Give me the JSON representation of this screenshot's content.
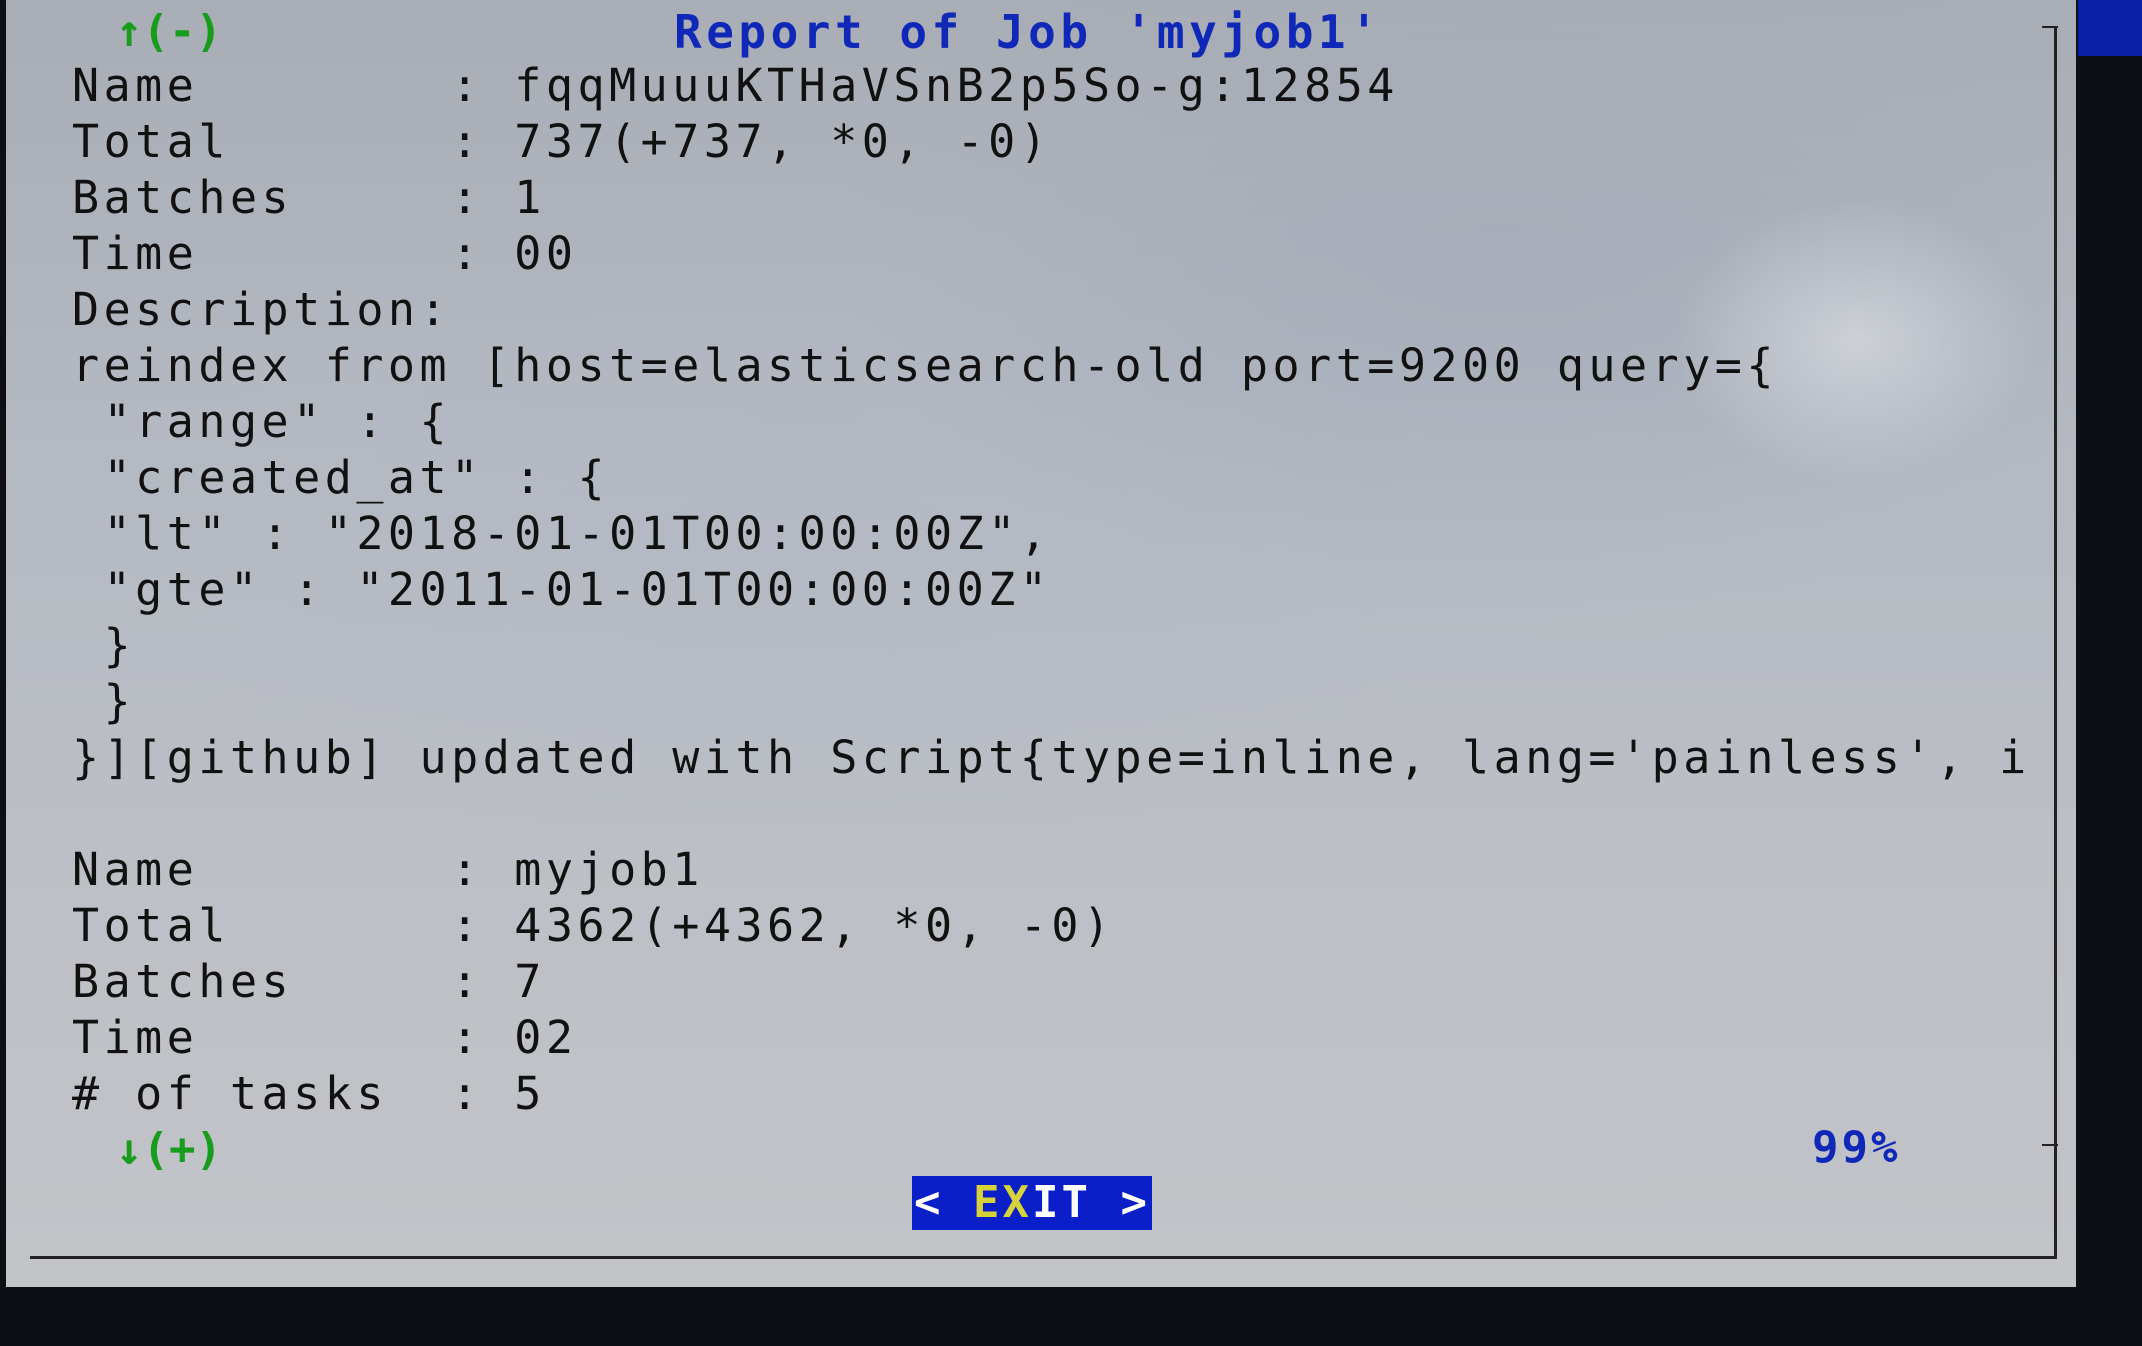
{
  "dialog": {
    "title": "Report of Job 'myjob1'",
    "scroll_up": "↑(-)",
    "scroll_down": "↓(+)",
    "progress_label": "99%",
    "progress": 0.99
  },
  "report_lines": [
    "Name        : fqqMuuuKTHaVSnB2p5So-g:12854",
    "Total       : 737(+737, *0, -0)",
    "Batches     : 1",
    "Time        : 00",
    "Description:",
    "reindex from [host=elasticsearch-old port=9200 query={",
    " \"range\" : {",
    " \"created_at\" : {",
    " \"lt\" : \"2018-01-01T00:00:00Z\",",
    " \"gte\" : \"2011-01-01T00:00:00Z\"",
    " }",
    " }",
    "}][github] updated with Script{type=inline, lang='painless', idOr",
    "",
    "Name        : myjob1",
    "Total       : 4362(+4362, *0, -0)",
    "Batches     : 7",
    "Time        : 02",
    "# of tasks  : 5"
  ],
  "exit_button": {
    "left": "< ",
    "hot": "EX",
    "rest": "IT",
    "right": " >"
  },
  "colors": {
    "title": "#1028b8",
    "scroll_indicator": "#179c1c",
    "button_bg": "#0a1fc8",
    "button_hotkey": "#d8d23a"
  }
}
